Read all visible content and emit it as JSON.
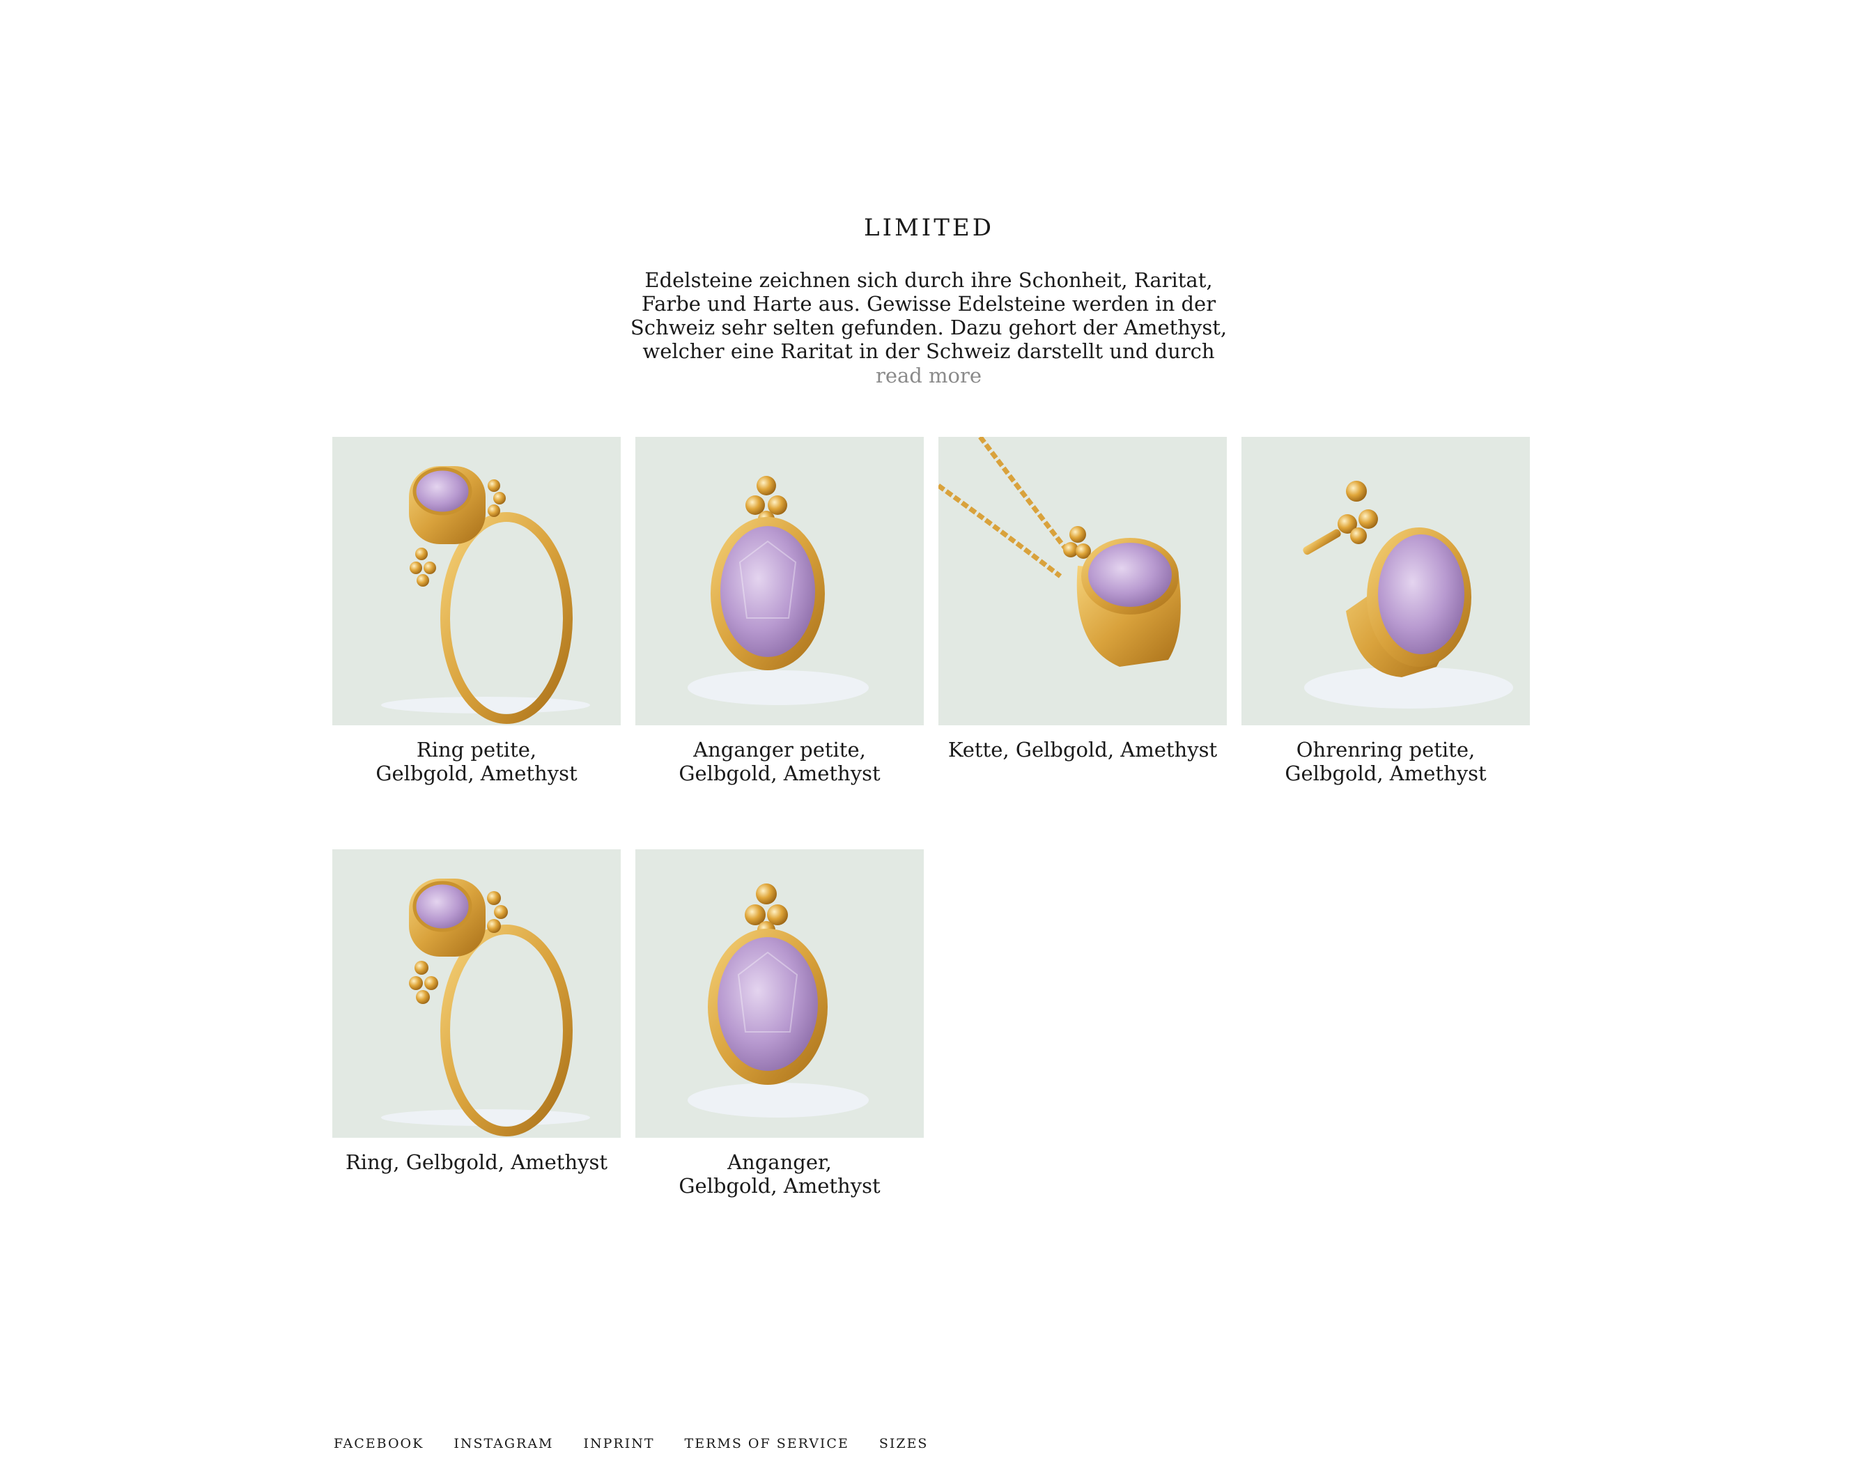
{
  "page": {
    "title": "LIMITED",
    "intro": "Edelsteine zeichnen sich durch ihre Schonheit, Raritat, Farbe und Harte aus. Gewisse Edelsteine werden in der Schweiz sehr selten gefunden. Dazu gehort der Amethyst, welcher eine Raritat in der Schweiz darstellt und durch",
    "read_more": "read more"
  },
  "products": [
    {
      "line1": "Ring petite,",
      "line2": "Gelbgold,  Amethyst",
      "icon": "ring-icon"
    },
    {
      "line1": "Anganger petite,",
      "line2": "Gelbgold,  Amethyst",
      "icon": "pendant-icon"
    },
    {
      "line1": "Kette,  Gelbgold,  Amethyst",
      "line2": "",
      "icon": "necklace-icon"
    },
    {
      "line1": "Ohrenring petite,",
      "line2": "Gelbgold,  Amethyst",
      "icon": "earring-icon"
    },
    {
      "line1": "Ring,  Gelbgold,  Amethyst",
      "line2": "",
      "icon": "ring-icon"
    },
    {
      "line1": "Anganger,",
      "line2": "Gelbgold,  Amethyst",
      "icon": "pendant-icon"
    }
  ],
  "footer": {
    "links": [
      "FACEBOOK",
      "INSTAGRAM",
      "INPRINT",
      "TERMS OF SERVICE",
      "SIZES"
    ]
  },
  "colors": {
    "tile_background": "#e2e9e3",
    "gold": "#d9a23c",
    "amethyst": "#b89ad0",
    "read_more": "#8a8a8a"
  }
}
